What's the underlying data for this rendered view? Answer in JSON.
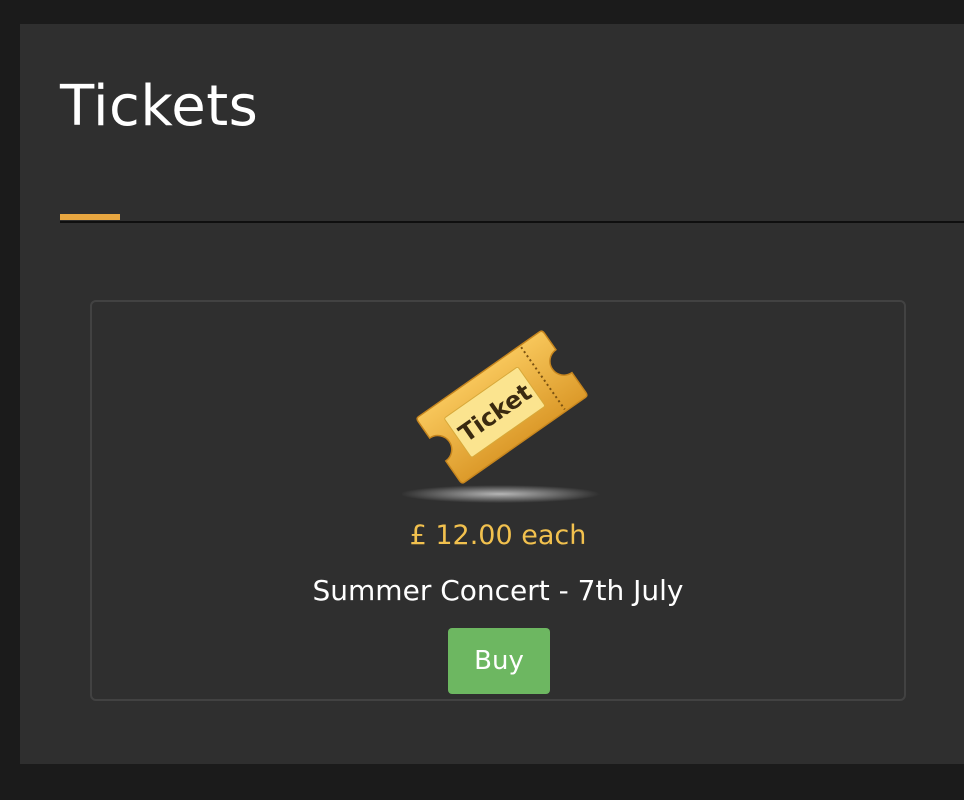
{
  "header": {
    "title": "Tickets"
  },
  "colors": {
    "accent": "#e8a640",
    "price": "#f2c14e",
    "buy_button": "#6db761",
    "panel_background": "#2f2f2f",
    "page_background": "#1b1b1b"
  },
  "ticket_card": {
    "image": {
      "icon": "ticket-icon",
      "text": "Ticket"
    },
    "price": "£ 12.00 each",
    "event_name": "Summer Concert - 7th July",
    "buy_label": "Buy"
  }
}
